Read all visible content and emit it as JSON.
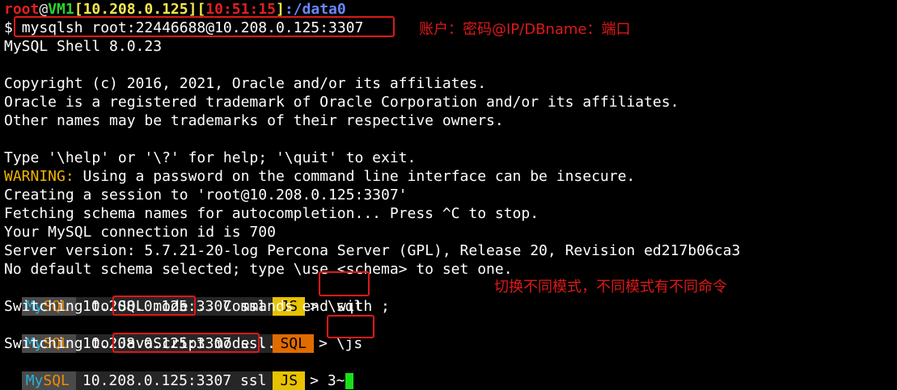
{
  "prompt_line": {
    "user": "root",
    "at": "@",
    "host": "VM1",
    "ip_open": "[",
    "ip": "10.208.0.125",
    "ip_close": "][",
    "time": "10:51:15",
    "time_close": "]",
    "path": ":/data0"
  },
  "command_line": {
    "dollar": "$ ",
    "command": "mysqlsh root:22446688@10.208.0.125:3307"
  },
  "output": {
    "version": "MySQL Shell 8.0.23",
    "copyright_1": "Copyright (c) 2016, 2021, Oracle and/or its affiliates.",
    "copyright_2": "Oracle is a registered trademark of Oracle Corporation and/or its affiliates.",
    "copyright_3": "Other names may be trademarks of their respective owners.",
    "help": "Type '\\help' or '\\?' for help; '\\quit' to exit.",
    "warning_label": "WARNING:",
    "warning_text": " Using a password on the command line interface can be insecure.",
    "session": "Creating a session to 'root@10.208.0.125:3307'",
    "fetching": "Fetching schema names for autocompletion... Press ^C to stop.",
    "connection_id": "Your MySQL connection id is 700",
    "server_version": "Server version: 5.7.21-20-log Percona Server (GPL), Release 20, Revision ed217b06ca3",
    "no_schema": "No default schema selected; type \\use <schema> to set one."
  },
  "mysqlsh_prompt": {
    "my": "My",
    "sql": "SQL",
    "host": "10.208.0.125:3307 ssl",
    "mode_js": "JS",
    "mode_sql": "SQL",
    "arrow": "> "
  },
  "interactions": [
    {
      "mode": "JS",
      "command": "\\sql",
      "response_prefix": "Switching to ",
      "response_mode": "SQL mode",
      "response_suffix": " .. Commands end with ;"
    },
    {
      "mode": "SQL",
      "command": "\\js",
      "response_prefix": "Switching to ",
      "response_mode": "JavaScript mode",
      "response_suffix": " .."
    }
  ],
  "last_prompt": {
    "mode": "JS",
    "input": "3~"
  },
  "annotations": {
    "account_note": "账户：密码@IP/DBname：端口",
    "mode_note": "切换不同模式，不同模式有不同命令"
  }
}
